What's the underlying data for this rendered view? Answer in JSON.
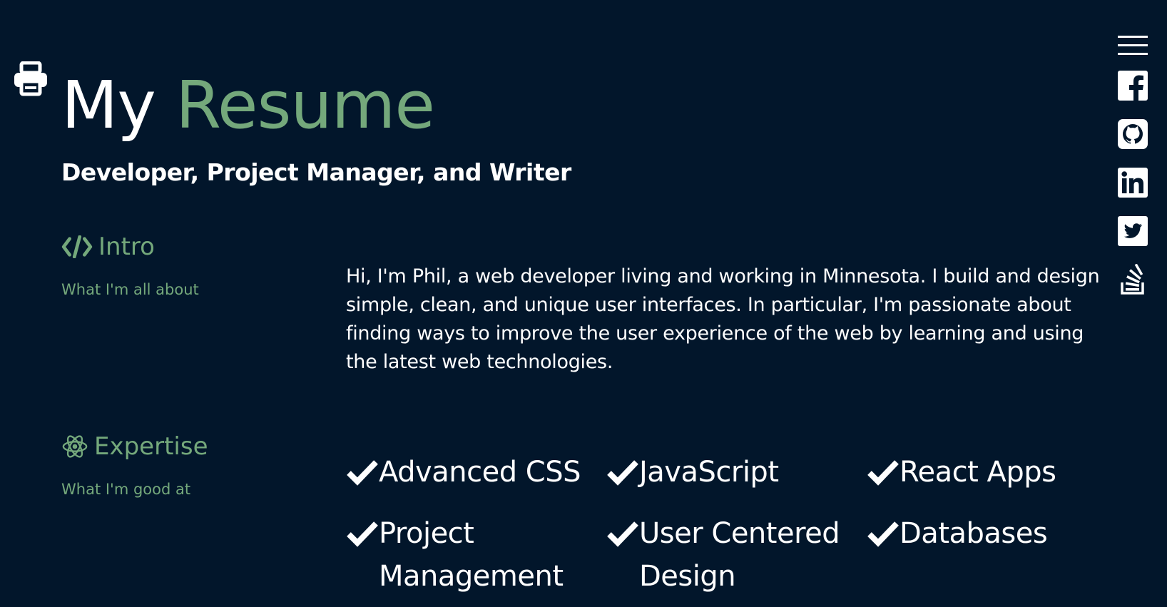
{
  "header": {
    "title_plain": "My",
    "title_accent": "Resume",
    "subtitle": "Developer, Project Manager, and Writer"
  },
  "toolbar": {
    "print_icon": "print-icon"
  },
  "sections": {
    "intro": {
      "icon": "code-icon",
      "heading": "Intro",
      "subheading": "What I'm all about",
      "body": "Hi, I'm Phil, a web developer living and working in Minnesota. I build and design simple, clean, and unique user interfaces. In particular, I'm passionate about finding ways to improve the user experience of the web by learning and using the latest web technologies."
    },
    "expertise": {
      "icon": "atom-icon",
      "heading": "Expertise",
      "subheading": "What I'm good at",
      "skills": [
        "Advanced CSS",
        "JavaScript",
        "React Apps",
        "Project Management",
        "User Centered Design",
        "Databases"
      ]
    }
  },
  "social": [
    "menu-icon",
    "facebook-icon",
    "github-icon",
    "linkedin-icon",
    "twitter-icon",
    "stackoverflow-icon"
  ],
  "colors": {
    "background": "#02162b",
    "accent": "#74a87b",
    "text": "#ffffff"
  }
}
